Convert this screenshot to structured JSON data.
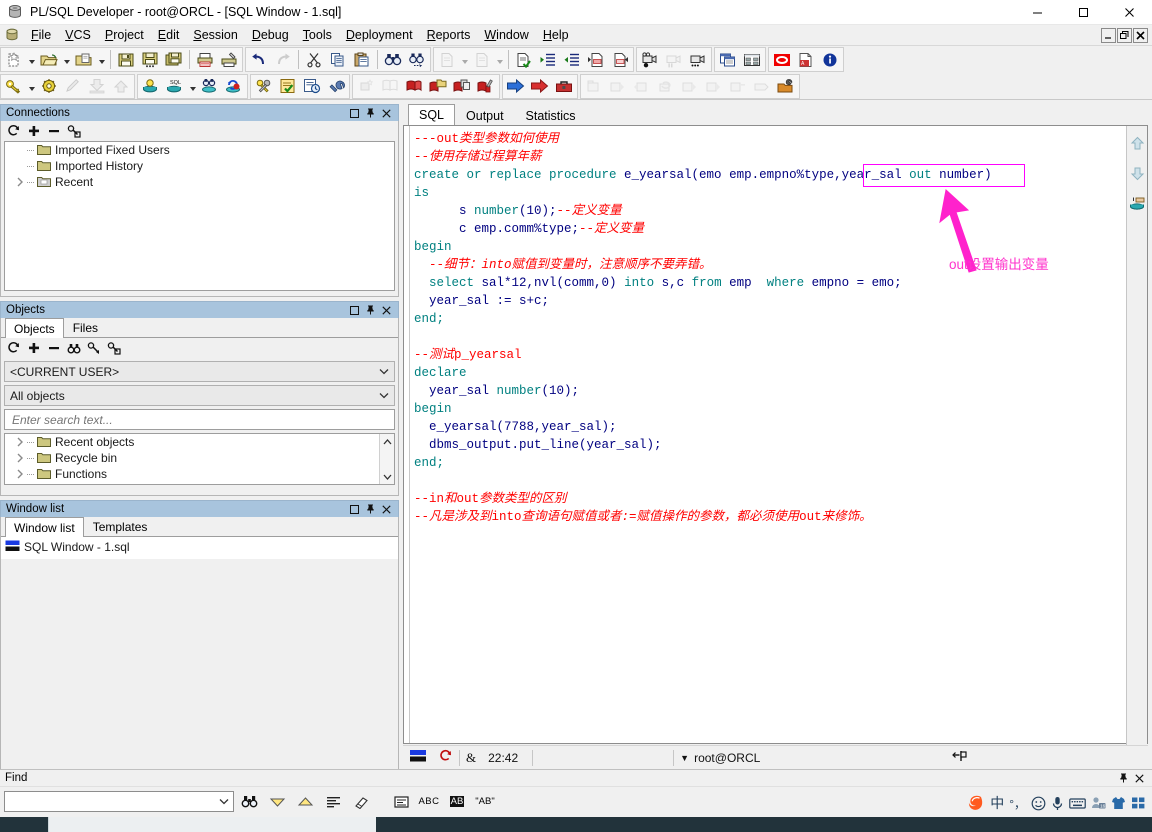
{
  "window": {
    "title": "PL/SQL Developer - root@ORCL - [SQL Window - 1.sql]",
    "app_icon": "database-barrel-icon",
    "minimize_label": "–",
    "maximize_label": "❐",
    "close_label": "✕"
  },
  "mdi_buttons": {
    "minimize": "_",
    "restore": "❐",
    "close": "✕"
  },
  "menu": {
    "icon": "app-menu-icon",
    "items": [
      {
        "label": "File",
        "accel": "F"
      },
      {
        "label": "VCS",
        "accel": "V"
      },
      {
        "label": "Project",
        "accel": "P"
      },
      {
        "label": "Edit",
        "accel": "E"
      },
      {
        "label": "Session",
        "accel": "S"
      },
      {
        "label": "Debug",
        "accel": "D"
      },
      {
        "label": "Tools",
        "accel": "T"
      },
      {
        "label": "Deployment",
        "accel": "D"
      },
      {
        "label": "Reports",
        "accel": "R"
      },
      {
        "label": "Window",
        "accel": "W"
      },
      {
        "label": "Help",
        "accel": "H"
      }
    ]
  },
  "toolbar_row1": [
    {
      "name": "new-object-button",
      "icon": "new-doc-icon",
      "dropdown": true,
      "disabled": false
    },
    {
      "name": "open-file-button",
      "icon": "open-folder-icon",
      "dropdown": true,
      "disabled": false
    },
    {
      "name": "recent-files-button",
      "icon": "folder-doc-icon",
      "dropdown": true,
      "disabled": false
    },
    {
      "name": "save-button",
      "icon": "floppy-icon",
      "disabled": false
    },
    {
      "name": "save-as-button",
      "icon": "floppy-dots-icon",
      "disabled": false
    },
    {
      "name": "save-all-button",
      "icon": "floppy-stack-icon",
      "disabled": false
    },
    {
      "name": "print-button",
      "icon": "printer-icon",
      "disabled": false
    },
    {
      "name": "print-setup-button",
      "icon": "printer-setup-icon",
      "disabled": false
    },
    {
      "name": "undo-button",
      "icon": "undo-arrow-icon",
      "disabled": false
    },
    {
      "name": "redo-button",
      "icon": "redo-arrow-icon",
      "disabled": true
    },
    {
      "name": "cut-button",
      "icon": "scissors-icon",
      "disabled": false
    },
    {
      "name": "copy-button",
      "icon": "copy-pages-icon",
      "disabled": false
    },
    {
      "name": "paste-button",
      "icon": "clipboard-icon",
      "disabled": false
    },
    {
      "name": "find-button",
      "icon": "binoculars-icon",
      "disabled": false
    },
    {
      "name": "find-next-button",
      "icon": "binoculars-next-icon",
      "disabled": false
    },
    {
      "name": "prev-edit-button",
      "icon": "page-left-icon",
      "dropdown": true,
      "disabled": true
    },
    {
      "name": "next-edit-button",
      "icon": "page-right-icon",
      "dropdown": true,
      "disabled": true
    },
    {
      "name": "syntax-check-button",
      "icon": "page-check-icon",
      "disabled": false
    },
    {
      "name": "indent-button",
      "icon": "indent-icon",
      "disabled": false
    },
    {
      "name": "outdent-button",
      "icon": "outdent-icon",
      "disabled": false
    },
    {
      "name": "comment-button",
      "icon": "page-comment-icon",
      "disabled": false
    },
    {
      "name": "uncomment-button",
      "icon": "page-uncomment-icon",
      "disabled": false
    },
    {
      "name": "record-macro-button",
      "icon": "camera-record-icon",
      "disabled": false
    },
    {
      "name": "pause-macro-button",
      "icon": "camera-pause-icon",
      "disabled": true
    },
    {
      "name": "play-macro-button",
      "icon": "camera-play-icon",
      "disabled": false
    },
    {
      "name": "window-list-button",
      "icon": "windows-cascade-icon",
      "disabled": false
    },
    {
      "name": "tile-windows-button",
      "icon": "windows-tile-icon",
      "disabled": false
    },
    {
      "name": "oracle-button",
      "icon": "oracle-logo-icon",
      "disabled": false
    },
    {
      "name": "pdf-export-button",
      "icon": "pdf-icon",
      "disabled": false
    },
    {
      "name": "about-button",
      "icon": "info-icon",
      "disabled": false
    }
  ],
  "toolbar_row2": [
    {
      "name": "logon-button",
      "icon": "key-icon",
      "dropdown": true,
      "disabled": false
    },
    {
      "name": "preferences-button",
      "icon": "gear-icon",
      "disabled": false
    },
    {
      "name": "pencil-button",
      "icon": "pencil-icon",
      "disabled": true
    },
    {
      "name": "import-button",
      "icon": "import-down-icon",
      "disabled": true
    },
    {
      "name": "export-button",
      "icon": "export-up-icon",
      "disabled": true
    },
    {
      "name": "new-session-button",
      "icon": "db-bulb-icon",
      "disabled": false
    },
    {
      "name": "sql-window-button",
      "icon": "db-sql-icon",
      "dropdown": true,
      "disabled": false
    },
    {
      "name": "find-db-object-button",
      "icon": "db-binoculars-icon",
      "disabled": false
    },
    {
      "name": "rollback-db-button",
      "icon": "db-rollback-icon",
      "disabled": false
    },
    {
      "name": "compile-invalid-button",
      "icon": "keys-pair-icon",
      "disabled": false
    },
    {
      "name": "test-script-button",
      "icon": "checklist-icon",
      "disabled": false
    },
    {
      "name": "session-info-button",
      "icon": "report-clock-icon",
      "disabled": false
    },
    {
      "name": "tools-wrench-button",
      "icon": "wrench-icon",
      "disabled": false
    },
    {
      "name": "debug-step-button",
      "icon": "spark-icon",
      "disabled": true
    },
    {
      "name": "book-button",
      "icon": "book-icon",
      "disabled": true
    },
    {
      "name": "breakpoint-button",
      "icon": "red-book-icon",
      "disabled": false
    },
    {
      "name": "breakpoint-add-button",
      "icon": "red-book-folder-icon",
      "disabled": false
    },
    {
      "name": "breakpoint-copy-button",
      "icon": "red-book-copy-icon",
      "disabled": false
    },
    {
      "name": "breakpoint-paint-button",
      "icon": "red-book-brush-icon",
      "disabled": false
    },
    {
      "name": "execute-button",
      "icon": "blue-arrow-icon",
      "disabled": false
    },
    {
      "name": "execute-red-button",
      "icon": "red-arrow-icon",
      "disabled": false
    },
    {
      "name": "stop-button",
      "icon": "toolbox-icon",
      "disabled": false
    },
    {
      "name": "debug-start-button",
      "icon": "dbg-start-icon",
      "disabled": true
    },
    {
      "name": "debug-run-button",
      "icon": "dbg-run-icon",
      "disabled": true
    },
    {
      "name": "debug-stop-button",
      "icon": "dbg-stop-icon",
      "disabled": true
    },
    {
      "name": "debug-restart-button",
      "icon": "dbg-restart-icon",
      "disabled": true
    },
    {
      "name": "debug-step-into-button",
      "icon": "dbg-step-into-icon",
      "disabled": true
    },
    {
      "name": "debug-step-over-button",
      "icon": "dbg-step-over-icon",
      "disabled": true
    },
    {
      "name": "debug-step-out-button",
      "icon": "dbg-step-out-icon",
      "disabled": true
    },
    {
      "name": "debug-run-to-button",
      "icon": "dbg-run-to-icon",
      "disabled": true
    },
    {
      "name": "debug-break-button",
      "icon": "dbg-break-icon",
      "disabled": true
    },
    {
      "name": "debug-watch-button",
      "icon": "dbg-watch-icon",
      "disabled": true
    },
    {
      "name": "debug-eval-button",
      "icon": "dbg-eval-icon",
      "disabled": true
    },
    {
      "name": "debug-settings-button",
      "icon": "dbg-settings-icon",
      "disabled": false
    }
  ],
  "connections_panel": {
    "title": "Connections",
    "caption_buttons": [
      "maximize-icon",
      "pin-icon",
      "close-icon"
    ],
    "mini_toolbar": [
      "refresh-icon",
      "add-icon",
      "remove-icon",
      "key-user-icon"
    ],
    "tree": [
      {
        "label": "Imported Fixed Users",
        "icon": "folder-icon",
        "expandable": false
      },
      {
        "label": "Imported History",
        "icon": "folder-icon",
        "expandable": false
      },
      {
        "label": "Recent",
        "icon": "folder-gray-icon",
        "expandable": true
      }
    ]
  },
  "objects_panel": {
    "title": "Objects",
    "caption_buttons": [
      "maximize-icon",
      "pin-icon",
      "close-icon"
    ],
    "tabs": [
      {
        "label": "Objects",
        "active": true
      },
      {
        "label": "Files",
        "active": false
      }
    ],
    "mini_toolbar": [
      "refresh-icon",
      "add-icon",
      "remove-icon",
      "binoculars-icon",
      "filter-icon",
      "key-user-icon"
    ],
    "user_select": {
      "value": "<CURRENT USER>",
      "name": "user-select"
    },
    "object_filter_select": {
      "value": "All objects",
      "name": "object-filter-select"
    },
    "search": {
      "placeholder": "Enter search text...",
      "value": ""
    },
    "tree": [
      {
        "label": "Recent objects",
        "icon": "folder-icon",
        "expandable": true
      },
      {
        "label": "Recycle bin",
        "icon": "folder-icon",
        "expandable": true
      },
      {
        "label": "Functions",
        "icon": "folder-icon",
        "expandable": true
      }
    ]
  },
  "window_list_panel": {
    "title": "Window list",
    "caption_buttons": [
      "maximize-icon",
      "pin-icon",
      "close-icon"
    ],
    "tabs": [
      {
        "label": "Window list",
        "active": true
      },
      {
        "label": "Templates",
        "active": false
      }
    ],
    "items": [
      {
        "label": "SQL Window - 1.sql",
        "icon": "sql-window-icon"
      }
    ]
  },
  "editor": {
    "tabs": [
      {
        "label": "SQL",
        "active": true
      },
      {
        "label": "Output",
        "active": false
      },
      {
        "label": "Statistics",
        "active": false
      }
    ],
    "right_tools": [
      "scroll-up-icon",
      "scroll-down-icon",
      "db-result-icon"
    ],
    "code_lines": [
      [
        {
          "t": "---out",
          "c": "cmn"
        },
        {
          "t": "类型参数如何使用",
          "c": "cm"
        }
      ],
      [
        {
          "t": "--",
          "c": "cmn"
        },
        {
          "t": "使用存储过程算年薪",
          "c": "cm"
        }
      ],
      [
        {
          "t": "create or replace procedure ",
          "c": "k"
        },
        {
          "t": "e_yearsal(emo emp.empno%type,year_sal ",
          "c": "id"
        },
        {
          "t": "out ",
          "c": "k"
        },
        {
          "t": "number)",
          "c": "id"
        }
      ],
      [
        {
          "t": "is",
          "c": "k"
        }
      ],
      [
        {
          "t": "      s ",
          "c": "id"
        },
        {
          "t": "number",
          "c": "k"
        },
        {
          "t": "(10);",
          "c": "pn"
        },
        {
          "t": "--",
          "c": "cmn"
        },
        {
          "t": "定义变量",
          "c": "cm"
        }
      ],
      [
        {
          "t": "      c emp.comm%type;",
          "c": "id"
        },
        {
          "t": "--",
          "c": "cmn"
        },
        {
          "t": "定义变量",
          "c": "cm"
        }
      ],
      [
        {
          "t": "begin",
          "c": "k"
        }
      ],
      [
        {
          "t": "  --",
          "c": "cmn"
        },
        {
          "t": "细节：into赋值到变量时，注意顺序不要弄错。",
          "c": "cm"
        }
      ],
      [
        {
          "t": "  ",
          "c": "id"
        },
        {
          "t": "select ",
          "c": "k"
        },
        {
          "t": "sal*12,nvl(comm,0) ",
          "c": "id"
        },
        {
          "t": "into ",
          "c": "k"
        },
        {
          "t": "s,c ",
          "c": "id"
        },
        {
          "t": "from ",
          "c": "k"
        },
        {
          "t": "emp  ",
          "c": "id"
        },
        {
          "t": "where ",
          "c": "k"
        },
        {
          "t": "empno = emo;",
          "c": "id"
        }
      ],
      [
        {
          "t": "  year_sal := s+c;",
          "c": "id"
        }
      ],
      [
        {
          "t": "end;",
          "c": "k"
        }
      ],
      [
        {
          "t": "",
          "c": "id"
        }
      ],
      [
        {
          "t": "--",
          "c": "cmn"
        },
        {
          "t": "测试",
          "c": "cm"
        },
        {
          "t": "p_yearsal",
          "c": "cmn"
        }
      ],
      [
        {
          "t": "declare",
          "c": "k"
        }
      ],
      [
        {
          "t": "  year_sal ",
          "c": "id"
        },
        {
          "t": "number",
          "c": "k"
        },
        {
          "t": "(10);",
          "c": "pn"
        }
      ],
      [
        {
          "t": "begin",
          "c": "k"
        }
      ],
      [
        {
          "t": "  e_yearsal(7788,year_sal);",
          "c": "id"
        }
      ],
      [
        {
          "t": "  dbms_output.put_line(year_sal);",
          "c": "id"
        }
      ],
      [
        {
          "t": "end;",
          "c": "k"
        }
      ],
      [
        {
          "t": "",
          "c": "id"
        }
      ],
      [
        {
          "t": "--in",
          "c": "cmn"
        },
        {
          "t": "和",
          "c": "cm"
        },
        {
          "t": "out",
          "c": "cmn"
        },
        {
          "t": "参数类型的区别",
          "c": "cm"
        }
      ],
      [
        {
          "t": "--",
          "c": "cmn"
        },
        {
          "t": "凡是涉及到",
          "c": "cm"
        },
        {
          "t": "into",
          "c": "cmn"
        },
        {
          "t": "查询语句赋值或者:=赋值操作的参数，都必须使用",
          "c": "cm"
        },
        {
          "t": "out",
          "c": "cmn"
        },
        {
          "t": "来修饰。",
          "c": "cm"
        }
      ]
    ],
    "annotation": {
      "highlight_color": "#ff00ff",
      "text": "out设置输出变量",
      "text_color": "#ff33cc"
    }
  },
  "status_bar": {
    "left_icon": "sql-window-icon",
    "refresh_icon": "refresh-red-icon",
    "lock_icon": "ampersand-icon",
    "time": "22:42",
    "connection": "root@ORCL",
    "connection_dropdown": "▼",
    "pin_icon": "pin-flag-icon"
  },
  "find_bar": {
    "title": "Find",
    "caption_buttons": [
      "pin-icon",
      "close-icon"
    ],
    "input": {
      "value": "",
      "placeholder": ""
    },
    "buttons": [
      {
        "name": "find-button",
        "icon": "binoculars-icon"
      },
      {
        "name": "find-next-button",
        "icon": "down-triangle-icon"
      },
      {
        "name": "find-prev-button",
        "icon": "up-triangle-icon"
      },
      {
        "name": "find-all-button",
        "icon": "lines-icon"
      },
      {
        "name": "clear-highlight-button",
        "icon": "eraser-icon"
      },
      {
        "name": "find-options-button",
        "icon": "panel-icon"
      },
      {
        "name": "match-case-button",
        "icon": "abc-icon",
        "label": "ABC"
      },
      {
        "name": "match-word-button",
        "icon": "abc-invert-icon",
        "label": "AB"
      },
      {
        "name": "regex-button",
        "icon": "quoted-ab-icon",
        "label": "\"AB\""
      }
    ]
  },
  "ime_tray": {
    "items": [
      {
        "name": "sogou-logo-icon",
        "label": "S"
      },
      {
        "name": "chinese-mode-icon",
        "label": "中"
      },
      {
        "name": "punctuation-icon",
        "label": "°，"
      },
      {
        "name": "emoji-icon",
        "label": "☺"
      },
      {
        "name": "microphone-icon",
        "label": "ᴘ"
      },
      {
        "name": "keyboard-icon",
        "label": "⌨"
      },
      {
        "name": "toolbox-icon",
        "label": "⚙"
      },
      {
        "name": "skin-icon",
        "label": "ὅ5"
      },
      {
        "name": "apps-icon",
        "label": "⊞"
      }
    ]
  },
  "taskbar": {
    "clock": ""
  }
}
